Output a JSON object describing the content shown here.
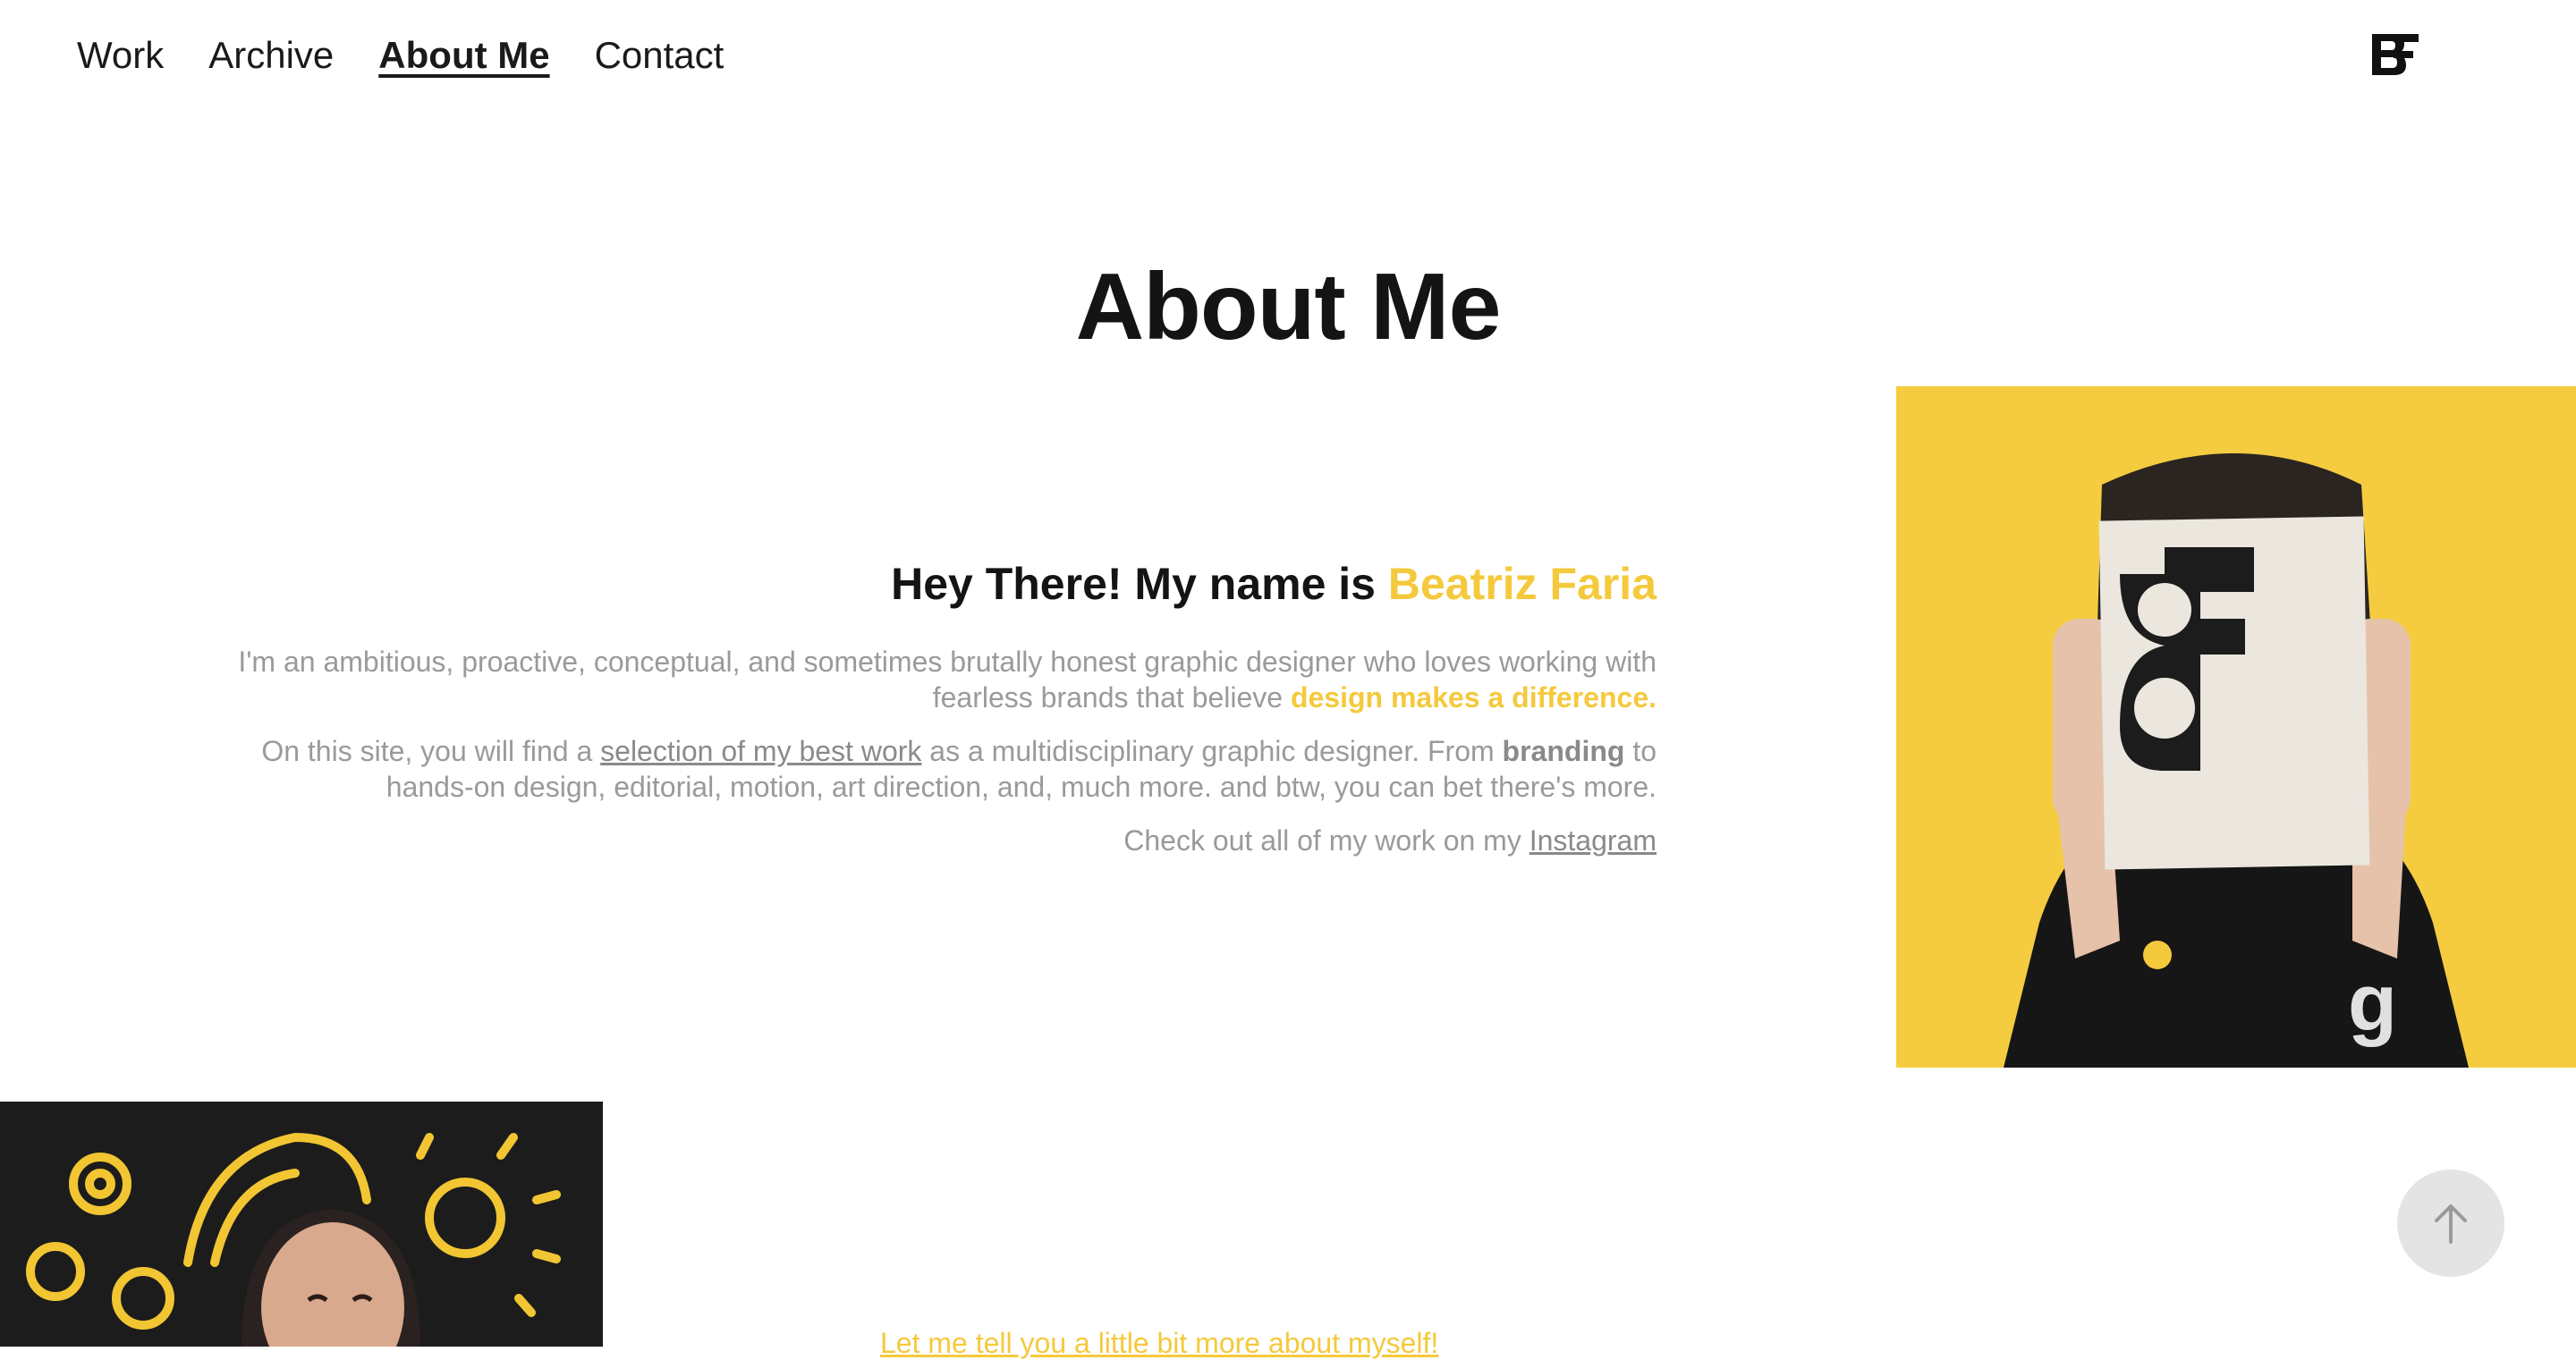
{
  "nav": {
    "items": [
      {
        "label": "Work",
        "active": false
      },
      {
        "label": "Archive",
        "active": false
      },
      {
        "label": "About Me",
        "active": true
      },
      {
        "label": "Contact",
        "active": false
      }
    ]
  },
  "logo": {
    "icon": "bf-monogram-logo"
  },
  "page": {
    "title": "About Me"
  },
  "intro": {
    "greeting": "Hey There! My name is ",
    "name": "Beatriz Faria",
    "p1_text": "I'm an ambitious, proactive, conceptual, and sometimes brutally honest graphic designer who loves working with fearless brands that believe ",
    "p1_highlight": "design makes a difference.",
    "p2_prefix": "On this site, you will find a ",
    "p2_link": "selection of my best work",
    "p2_middle": " as a multidisciplinary graphic designer. From ",
    "p2_bold": "branding",
    "p2_suffix": " to hands-on design, editorial, motion, art direction, and, much more. and btw, you can bet there's more.",
    "p3_prefix": "Check out all of my work on my ",
    "p3_link": "Instagram"
  },
  "teaser": {
    "text": "Let me tell you a little bit more about myself!"
  },
  "colors": {
    "accent": "#f5c93c",
    "text": "#141414",
    "muted": "#9a9a9a"
  },
  "scroll_top": {
    "icon": "arrow-up-icon"
  }
}
